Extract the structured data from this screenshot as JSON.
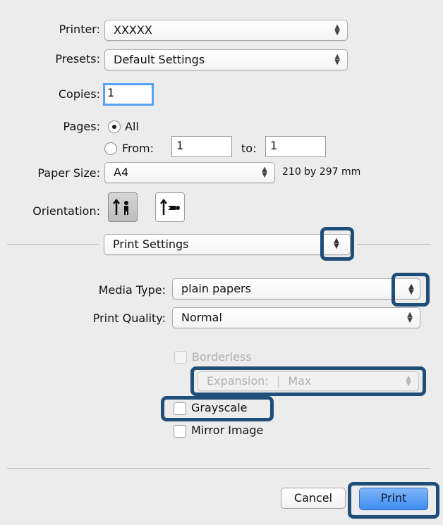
{
  "printer": {
    "label": "Printer:",
    "value": "XXXXX"
  },
  "presets": {
    "label": "Presets:",
    "value": "Default Settings"
  },
  "copies": {
    "label": "Copies:",
    "value": "1"
  },
  "pages": {
    "label": "Pages:",
    "all_label": "All",
    "from_label": "From:",
    "from_value": "1",
    "to_label": "to:",
    "to_value": "1",
    "selected": "All"
  },
  "paper_size": {
    "label": "Paper Size:",
    "value": "A4",
    "dimensions": "210 by 297 mm"
  },
  "orientation": {
    "label": "Orientation:",
    "selected": "portrait"
  },
  "section_menu": {
    "value": "Print Settings"
  },
  "media_type": {
    "label": "Media Type:",
    "value": "plain papers"
  },
  "print_quality": {
    "label": "Print Quality:",
    "value": "Normal"
  },
  "borderless": {
    "label": "Borderless",
    "checked": false,
    "enabled": false
  },
  "expansion": {
    "label": "Expansion:",
    "value": "Max",
    "enabled": false
  },
  "grayscale": {
    "label": "Grayscale",
    "checked": false
  },
  "mirror_image": {
    "label": "Mirror Image",
    "checked": false
  },
  "buttons": {
    "cancel": "Cancel",
    "print": "Print"
  },
  "colors": {
    "highlight": "#1f4e79",
    "primary_button": "#3e8cf0",
    "focus_ring": "#5aa2f5"
  }
}
